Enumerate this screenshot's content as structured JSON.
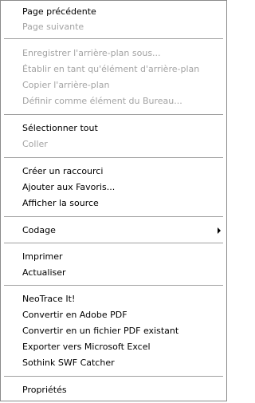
{
  "menu": {
    "items": [
      {
        "label": "Page précédente",
        "disabled": false
      },
      {
        "label": "Page suivante",
        "disabled": true
      },
      {
        "label": "Enregistrer l'arrière-plan sous...",
        "disabled": true
      },
      {
        "label": "Établir en tant qu'élément d'arrière-plan",
        "disabled": true
      },
      {
        "label": "Copier l'arrière-plan",
        "disabled": true
      },
      {
        "label": "Définir comme élément du Bureau...",
        "disabled": true
      },
      {
        "label": "Sélectionner tout",
        "disabled": false
      },
      {
        "label": "Coller",
        "disabled": true
      },
      {
        "label": "Créer un raccourci",
        "disabled": false
      },
      {
        "label": "Ajouter aux Favoris...",
        "disabled": false
      },
      {
        "label": "Afficher la source",
        "disabled": false
      },
      {
        "label": "Codage",
        "disabled": false,
        "submenu": "chevron-right-icon"
      },
      {
        "label": "Imprimer",
        "disabled": false
      },
      {
        "label": "Actualiser",
        "disabled": false
      },
      {
        "label": "NeoTrace It!",
        "disabled": false
      },
      {
        "label": "Convertir en Adobe PDF",
        "disabled": false
      },
      {
        "label": "Convertir en un fichier PDF existant",
        "disabled": false
      },
      {
        "label": "Exporter vers Microsoft Excel",
        "disabled": false
      },
      {
        "label": "Sothink SWF Catcher",
        "disabled": false
      },
      {
        "label": "Propriétés",
        "disabled": false
      }
    ],
    "colors": {
      "text": "#000000",
      "disabled_text": "#a3a3a3",
      "separator": "#a0a0a0",
      "border": "#8a8a8a",
      "background": "#ffffff"
    }
  }
}
